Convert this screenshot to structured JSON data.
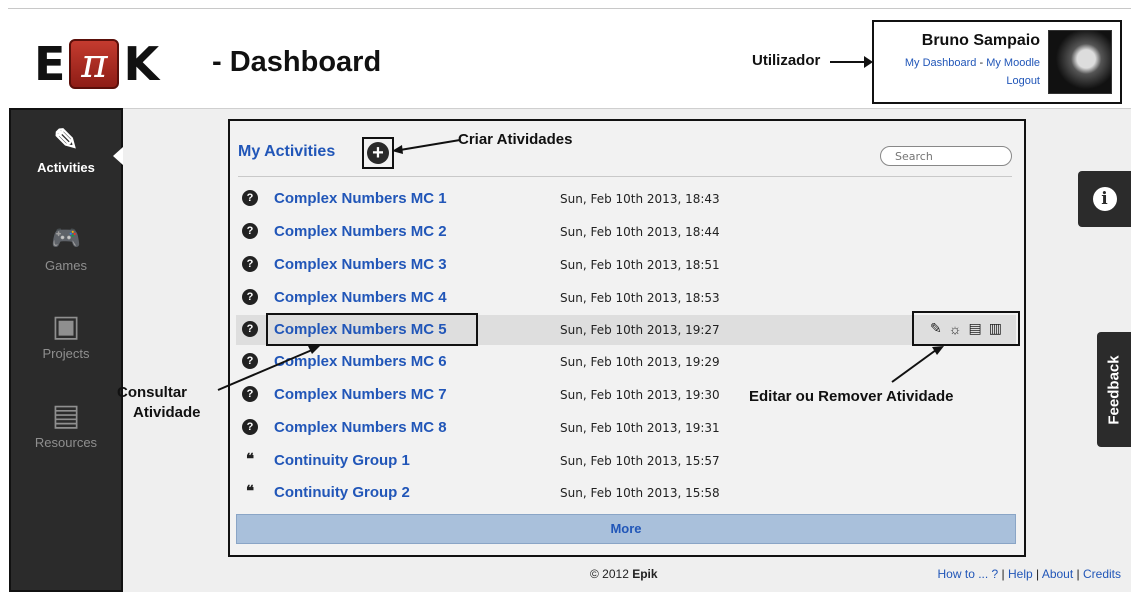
{
  "header": {
    "logo_e": "E",
    "logo_pi": "π",
    "logo_k": "K",
    "title": "- Dashboard"
  },
  "user": {
    "name": "Bruno Sampaio",
    "my_dashboard": "My Dashboard",
    "separator": " - ",
    "my_moodle": "My Moodle",
    "logout": "Logout"
  },
  "annotations": {
    "utilizador": "Utilizador",
    "criar": "Criar Atividades",
    "consultar_1": "Consultar",
    "consultar_2": "Atividade",
    "editar": "Editar ou Remover Atividade"
  },
  "sidebar": {
    "items": [
      {
        "label": "Activities",
        "icon": "edit-icon",
        "glyph": "✎"
      },
      {
        "label": "Games",
        "icon": "gamepad-icon",
        "glyph": "🎮"
      },
      {
        "label": "Projects",
        "icon": "window-icon",
        "glyph": "▣"
      },
      {
        "label": "Resources",
        "icon": "document-icon",
        "glyph": "▤"
      }
    ]
  },
  "panel": {
    "title": "My Activities",
    "search_placeholder": "Search",
    "more": "More"
  },
  "activities": [
    {
      "name": "Complex Numbers MC 1",
      "date": "Sun, Feb 10th 2013, 18:43",
      "type": "question"
    },
    {
      "name": "Complex Numbers MC 2",
      "date": "Sun, Feb 10th 2013, 18:44",
      "type": "question"
    },
    {
      "name": "Complex Numbers MC 3",
      "date": "Sun, Feb 10th 2013, 18:51",
      "type": "question"
    },
    {
      "name": "Complex Numbers MC 4",
      "date": "Sun, Feb 10th 2013, 18:53",
      "type": "question"
    },
    {
      "name": "Complex Numbers MC 5",
      "date": "Sun, Feb 10th 2013, 19:27",
      "type": "question"
    },
    {
      "name": "Complex Numbers MC 6",
      "date": "Sun, Feb 10th 2013, 19:29",
      "type": "question"
    },
    {
      "name": "Complex Numbers MC 7",
      "date": "Sun, Feb 10th 2013, 19:30",
      "type": "question"
    },
    {
      "name": "Complex Numbers MC 8",
      "date": "Sun, Feb 10th 2013, 19:31",
      "type": "question"
    },
    {
      "name": "Continuity Group 1",
      "date": "Sun, Feb 10th 2013, 15:57",
      "type": "group"
    },
    {
      "name": "Continuity Group 2",
      "date": "Sun, Feb 10th 2013, 15:58",
      "type": "group"
    }
  ],
  "footer": {
    "copyright": "© 2012 ",
    "brand": "Epik",
    "howto": "How to ... ?",
    "help": "Help",
    "about": "About",
    "credits": "Credits"
  },
  "right_tabs": {
    "info": "i",
    "feedback": "Feedback"
  }
}
